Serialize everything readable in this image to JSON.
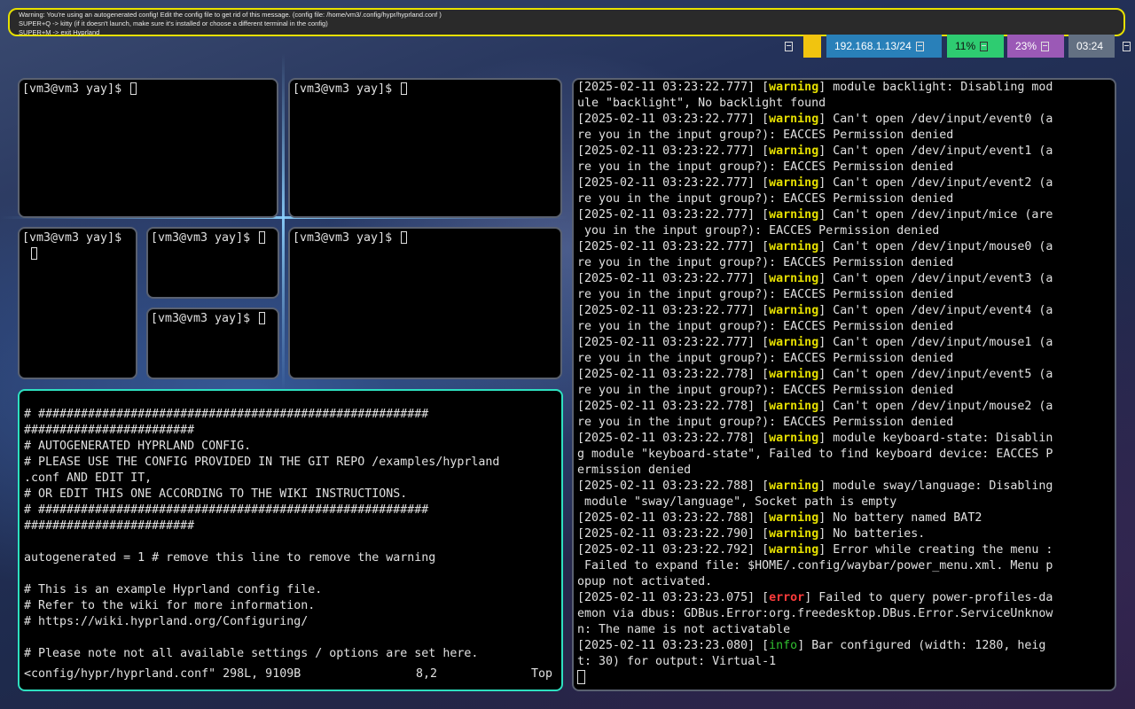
{
  "notification": {
    "lines": [
      "Warning: You're using an autogenerated config! Edit the config file to get rid of this message. (config file: /home/vm3/.config/hypr/hyprland.conf )",
      "SUPER+Q -> kitty (if it doesn't launch, make sure it's installed or choose a different terminal in the config)",
      "SUPER+M -> exit Hyprland"
    ],
    "border_color": "#e6e000"
  },
  "bar": {
    "network": "192.168.1.13/24",
    "cpu": "11%",
    "memory": "23%",
    "clock": "03:24",
    "colors": {
      "network": "#2980b9",
      "cpu": "#2ecc71",
      "memory": "#9b59b6",
      "clock": "#637082",
      "indicator": "#f1c40f"
    }
  },
  "terminals": {
    "t1": {
      "prompt": "[vm3@vm3 yay]$"
    },
    "t2": {
      "prompt": "[vm3@vm3 yay]$"
    },
    "t3": {
      "prompt": "[vm3@vm3 yay]$"
    },
    "t4": {
      "prompt": "[vm3@vm3 yay]$"
    },
    "t5": {
      "prompt": "[vm3@vm3 yay]$"
    },
    "t6": {
      "prompt": "[vm3@vm3 yay]$"
    }
  },
  "editor": {
    "lines": [
      "# #######################################################",
      "########################",
      "# AUTOGENERATED HYPRLAND CONFIG.",
      "# PLEASE USE THE CONFIG PROVIDED IN THE GIT REPO /examples/hyprland",
      ".conf AND EDIT IT,",
      "# OR EDIT THIS ONE ACCORDING TO THE WIKI INSTRUCTIONS.",
      "# #######################################################",
      "########################",
      "",
      "autogenerated = 1 # remove this line to remove the warning",
      "",
      "# This is an example Hyprland config file.",
      "# Refer to the wiki for more information.",
      "# https://wiki.hyprland.org/Configuring/",
      "",
      "# Please note not all available settings / options are set here."
    ],
    "status": {
      "file": "<config/hypr/hyprland.conf\" 298L, 9109B",
      "position": "8,2",
      "scroll": "Top"
    }
  },
  "log": {
    "lines": [
      {
        "pre": "[2025-02-11 03:23:22.777] [",
        "level": "warning",
        "post": "] module backlight: Disabling mod"
      },
      {
        "pre": "ule \"backlight\", No backlight found",
        "level": "",
        "post": ""
      },
      {
        "pre": "[2025-02-11 03:23:22.777] [",
        "level": "warning",
        "post": "] Can't open /dev/input/event0 (a"
      },
      {
        "pre": "re you in the input group?): EACCES Permission denied",
        "level": "",
        "post": ""
      },
      {
        "pre": "[2025-02-11 03:23:22.777] [",
        "level": "warning",
        "post": "] Can't open /dev/input/event1 (a"
      },
      {
        "pre": "re you in the input group?): EACCES Permission denied",
        "level": "",
        "post": ""
      },
      {
        "pre": "[2025-02-11 03:23:22.777] [",
        "level": "warning",
        "post": "] Can't open /dev/input/event2 (a"
      },
      {
        "pre": "re you in the input group?): EACCES Permission denied",
        "level": "",
        "post": ""
      },
      {
        "pre": "[2025-02-11 03:23:22.777] [",
        "level": "warning",
        "post": "] Can't open /dev/input/mice (are"
      },
      {
        "pre": " you in the input group?): EACCES Permission denied",
        "level": "",
        "post": ""
      },
      {
        "pre": "[2025-02-11 03:23:22.777] [",
        "level": "warning",
        "post": "] Can't open /dev/input/mouse0 (a"
      },
      {
        "pre": "re you in the input group?): EACCES Permission denied",
        "level": "",
        "post": ""
      },
      {
        "pre": "[2025-02-11 03:23:22.777] [",
        "level": "warning",
        "post": "] Can't open /dev/input/event3 (a"
      },
      {
        "pre": "re you in the input group?): EACCES Permission denied",
        "level": "",
        "post": ""
      },
      {
        "pre": "[2025-02-11 03:23:22.777] [",
        "level": "warning",
        "post": "] Can't open /dev/input/event4 (a"
      },
      {
        "pre": "re you in the input group?): EACCES Permission denied",
        "level": "",
        "post": ""
      },
      {
        "pre": "[2025-02-11 03:23:22.777] [",
        "level": "warning",
        "post": "] Can't open /dev/input/mouse1 (a"
      },
      {
        "pre": "re you in the input group?): EACCES Permission denied",
        "level": "",
        "post": ""
      },
      {
        "pre": "[2025-02-11 03:23:22.778] [",
        "level": "warning",
        "post": "] Can't open /dev/input/event5 (a"
      },
      {
        "pre": "re you in the input group?): EACCES Permission denied",
        "level": "",
        "post": ""
      },
      {
        "pre": "[2025-02-11 03:23:22.778] [",
        "level": "warning",
        "post": "] Can't open /dev/input/mouse2 (a"
      },
      {
        "pre": "re you in the input group?): EACCES Permission denied",
        "level": "",
        "post": ""
      },
      {
        "pre": "[2025-02-11 03:23:22.778] [",
        "level": "warning",
        "post": "] module keyboard-state: Disablin"
      },
      {
        "pre": "g module \"keyboard-state\", Failed to find keyboard device: EACCES P",
        "level": "",
        "post": ""
      },
      {
        "pre": "ermission denied",
        "level": "",
        "post": ""
      },
      {
        "pre": "[2025-02-11 03:23:22.788] [",
        "level": "warning",
        "post": "] module sway/language: Disabling"
      },
      {
        "pre": " module \"sway/language\", Socket path is empty",
        "level": "",
        "post": ""
      },
      {
        "pre": "[2025-02-11 03:23:22.788] [",
        "level": "warning",
        "post": "] No battery named BAT2"
      },
      {
        "pre": "[2025-02-11 03:23:22.790] [",
        "level": "warning",
        "post": "] No batteries."
      },
      {
        "pre": "[2025-02-11 03:23:22.792] [",
        "level": "warning",
        "post": "] Error while creating the menu :"
      },
      {
        "pre": " Failed to expand file: $HOME/.config/waybar/power_menu.xml. Menu p",
        "level": "",
        "post": ""
      },
      {
        "pre": "opup not activated.",
        "level": "",
        "post": ""
      },
      {
        "pre": "[2025-02-11 03:23:23.075] [",
        "level": "error",
        "post": "] Failed to query power-profiles-da"
      },
      {
        "pre": "emon via dbus: GDBus.Error:org.freedesktop.DBus.Error.ServiceUnknow",
        "level": "",
        "post": ""
      },
      {
        "pre": "n: The name is not activatable",
        "level": "",
        "post": ""
      },
      {
        "pre": "[2025-02-11 03:23:23.080] [",
        "level": "info",
        "post": "] Bar configured (width: 1280, heig"
      },
      {
        "pre": "t: 30) for output: Virtual-1",
        "level": "",
        "post": ""
      }
    ]
  }
}
